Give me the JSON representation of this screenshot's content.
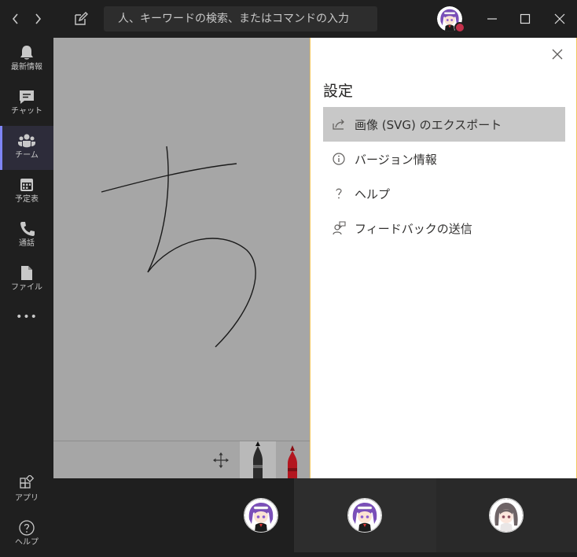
{
  "titlebar": {
    "back_icon": "chevron-left-icon",
    "forward_icon": "chevron-right-icon",
    "compose_icon": "compose-icon",
    "search_placeholder": "人、キーワードの検索、またはコマンドの入力",
    "presence_color": "#c4314b",
    "window_controls": [
      "minimize-icon",
      "maximize-icon",
      "close-icon"
    ]
  },
  "rail": {
    "items": [
      {
        "label": "最新情報",
        "icon": "bell-icon"
      },
      {
        "label": "チャット",
        "icon": "chat-icon"
      },
      {
        "label": "チーム",
        "icon": "teams-icon",
        "active": true
      },
      {
        "label": "予定表",
        "icon": "calendar-icon"
      },
      {
        "label": "通話",
        "icon": "phone-icon"
      },
      {
        "label": "ファイル",
        "icon": "file-icon"
      }
    ],
    "more": "•••",
    "apps_label": "アプリ",
    "help_label": "ヘルプ",
    "accent": "#7f85f5"
  },
  "whiteboard": {
    "background": "#a6a6a6",
    "tools": [
      "move-icon",
      "black-pen-icon",
      "red-pen-icon"
    ]
  },
  "settings": {
    "title": "設定",
    "items": [
      {
        "label": "画像 (SVG) のエクスポート",
        "icon": "share-icon",
        "highlighted": true
      },
      {
        "label": "バージョン情報",
        "icon": "info-icon"
      },
      {
        "label": "ヘルプ",
        "icon": "question-icon"
      },
      {
        "label": "フィードバックの送信",
        "icon": "feedback-icon"
      }
    ],
    "border_color": "#f2c55c"
  },
  "participants": [
    "avatar-purple-hair",
    "avatar-purple-hair",
    "avatar-gray-hair"
  ]
}
